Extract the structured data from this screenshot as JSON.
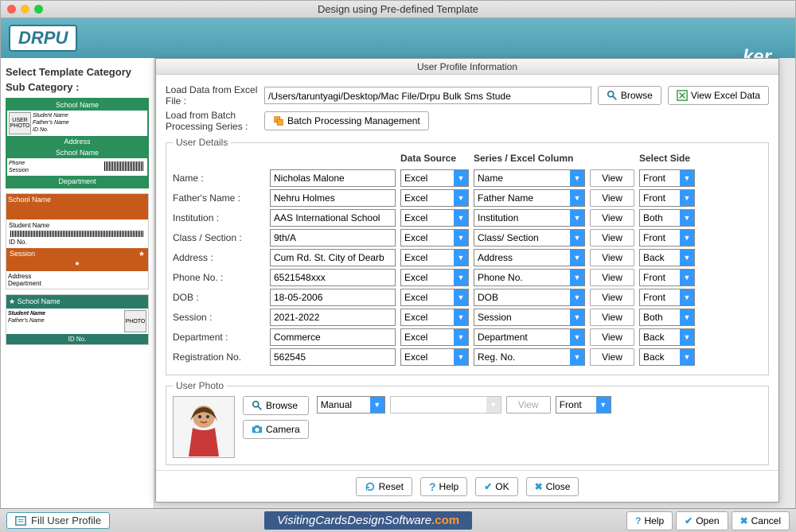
{
  "window": {
    "title": "Design using Pre-defined Template"
  },
  "banner": {
    "logo": "DRPU",
    "suffix": "ker"
  },
  "sidebar": {
    "template_category_label": "Select Template Category",
    "sub_category_label": "Sub Category :",
    "tpl1": {
      "school": "School Name",
      "student": "Student Name",
      "father": "Father's Name",
      "id": "ID No.",
      "address": "Address",
      "phone": "Phone",
      "session": "Session",
      "department": "Department"
    },
    "tpl2": {
      "school": "School Name",
      "student": "Student Name",
      "id": "ID No.",
      "session": "Session",
      "address": "Address",
      "department": "Department"
    },
    "tpl3": {
      "school": "School Name",
      "student": "Student Name",
      "father": "Father's Name",
      "id": "ID No."
    }
  },
  "modal": {
    "title": "User Profile Information",
    "load_excel_label": "Load Data from Excel File :",
    "excel_path": "/Users/taruntyagi/Desktop/Mac File/Drpu Bulk Sms Stude",
    "browse_label": "Browse",
    "view_excel_label": "View Excel Data",
    "load_batch_label": "Load from Batch Processing Series :",
    "batch_btn": "Batch Processing Management",
    "user_details_legend": "User Details",
    "user_photo_legend": "User Photo",
    "headers": {
      "data_source": "Data Source",
      "series_col": "Series / Excel Column",
      "select_side": "Select Side"
    },
    "fields": [
      {
        "label": "Name :",
        "value": "Nicholas Malone",
        "source": "Excel",
        "column": "Name",
        "side": "Front"
      },
      {
        "label": "Father's Name :",
        "value": "Nehru Holmes",
        "source": "Excel",
        "column": "Father Name",
        "side": "Front"
      },
      {
        "label": "Institution :",
        "value": "AAS International School",
        "source": "Excel",
        "column": "Institution",
        "side": "Both"
      },
      {
        "label": "Class / Section :",
        "value": "9th/A",
        "source": "Excel",
        "column": "Class/ Section",
        "side": "Front"
      },
      {
        "label": "Address :",
        "value": "Cum Rd. St. City of Dearb",
        "source": "Excel",
        "column": "Address",
        "side": "Back"
      },
      {
        "label": "Phone No. :",
        "value": "6521548xxx",
        "source": "Excel",
        "column": "Phone No.",
        "side": "Front"
      },
      {
        "label": "DOB :",
        "value": "18-05-2006",
        "source": "Excel",
        "column": "DOB",
        "side": "Front"
      },
      {
        "label": "Session :",
        "value": "2021-2022",
        "source": "Excel",
        "column": "Session",
        "side": "Both"
      },
      {
        "label": "Department :",
        "value": "Commerce",
        "source": "Excel",
        "column": "Department",
        "side": "Back"
      },
      {
        "label": "Registration No.",
        "value": "562545",
        "source": "Excel",
        "column": "Reg. No.",
        "side": "Back"
      }
    ],
    "view_label": "View",
    "photo": {
      "browse": "Browse",
      "camera": "Camera",
      "source": "Manual",
      "column": "",
      "side": "Front"
    },
    "footer": {
      "reset": "Reset",
      "help": "Help",
      "ok": "OK",
      "close": "Close"
    }
  },
  "bottombar": {
    "fill_profile": "Fill User Profile",
    "url_prefix": "VisitingCardsDesignSoftware",
    "url_suffix": ".com",
    "help": "Help",
    "open": "Open",
    "cancel": "Cancel"
  }
}
